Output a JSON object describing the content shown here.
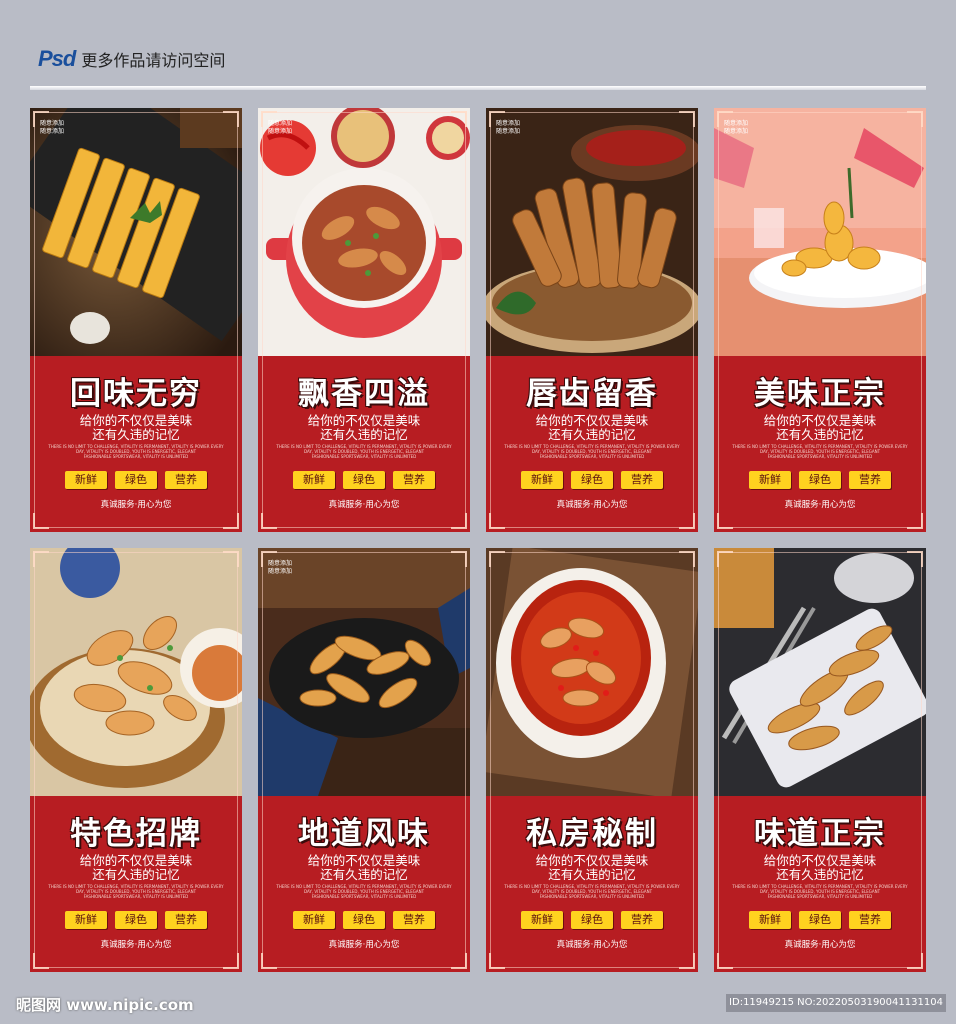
{
  "header": {
    "logo": "Psd",
    "text": "更多作品请访问空间"
  },
  "common": {
    "tag_line1": "随意添加",
    "tag_line2": "随意添加",
    "sub1": "给你的不仅仅是美味",
    "sub2": "还有久违的记忆",
    "small1": "THERE IS NO LIMIT TO CHALLENGE, VITALITY IS PERMANENT, VITALITY IS POWER EVERY",
    "small2": "DAY, VITALITY IS DOUBLED, YOUTH IS ENERGETIC, ELEGANT",
    "small3": "FASHIONABLE SPORTSWEAR, VITALITY IS UNLIMITED",
    "pills": [
      "新鲜",
      "绿色",
      "营养"
    ],
    "footer": "真诚服务·用心为您"
  },
  "cards": [
    {
      "title": "回味无穷"
    },
    {
      "title": "飘香四溢"
    },
    {
      "title": "唇齿留香"
    },
    {
      "title": "美味正宗"
    },
    {
      "title": "特色招牌"
    },
    {
      "title": "地道风味"
    },
    {
      "title": "私房秘制"
    },
    {
      "title": "味道正宗"
    }
  ],
  "watermark": {
    "left": "昵图网 www.nipic.com",
    "right": "ID:11949215 NO:20220503190041131104"
  },
  "colors": {
    "background": "#b9bcc6",
    "card_red": "#b71d22",
    "pill_yellow": "#ffd21f",
    "title_white": "#ffffff"
  }
}
